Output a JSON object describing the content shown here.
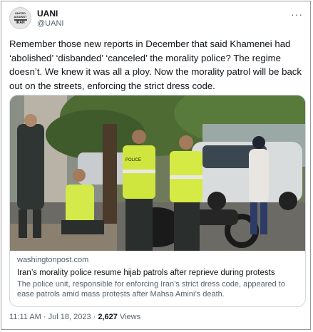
{
  "account": {
    "avatar_lines": [
      "UANI",
      "UNITED",
      "AGAINST",
      "NUCLEAR",
      "IRAN"
    ],
    "name": "UANI",
    "handle": "@UANI",
    "more_icon": "more-horizontal-icon"
  },
  "tweet": {
    "text": "Remember those new reports in December that said Khamenei had ‘abolished’ ‘disbanded’ ‘canceled’ the morality police? The regime doesn’t. We knew it was all a ploy. Now the morality patrol will be back out on the streets, enforcing the strict dress code."
  },
  "card": {
    "domain": "washingtonpost.com",
    "title": "Iran’s morality police resume hijab patrols after reprieve during protests",
    "description": "The police unit, responsible for enforcing Iran’s strict dress code, appeared to ease patrols amid mass protests after Mahsa Amini’s death.",
    "photo_vest_text": "POLICE"
  },
  "meta": {
    "time": "11:11 AM",
    "date": "Jul 18, 2023",
    "separator": "·",
    "views_count": "2,627",
    "views_label": "Views"
  }
}
